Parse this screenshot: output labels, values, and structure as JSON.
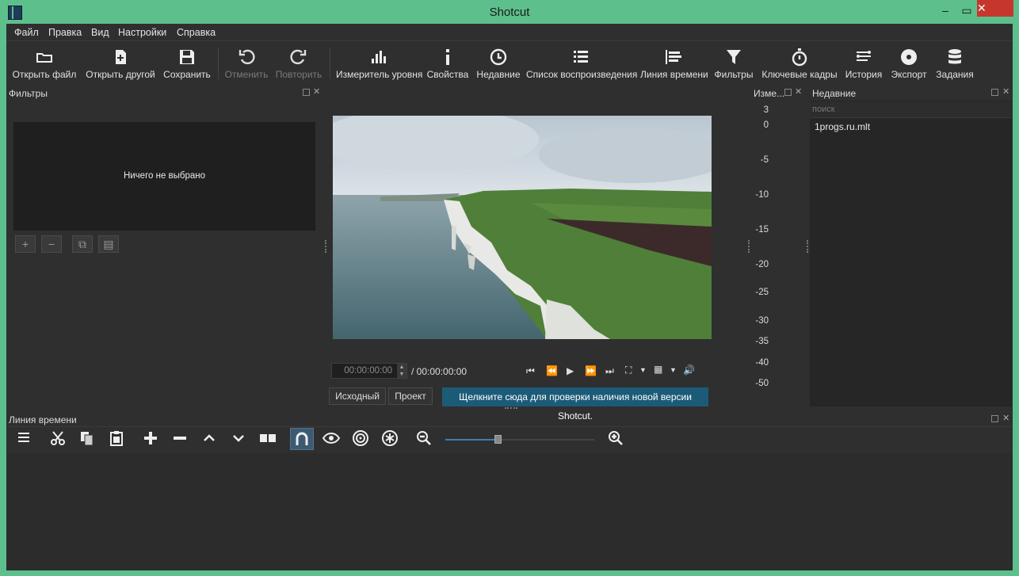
{
  "window": {
    "title": "Shotcut"
  },
  "menu": [
    "Файл",
    "Правка",
    "Вид",
    "Настройки",
    "Справка"
  ],
  "toolbar": {
    "open_file": "Открыть файл",
    "open_other": "Открыть другой",
    "save": "Сохранить",
    "undo": "Отменить",
    "redo": "Повторить",
    "peak_meter": "Измеритель уровня",
    "properties": "Свойства",
    "recent": "Недавние",
    "playlist": "Список воспроизведения",
    "timeline": "Линия времени",
    "filters": "Фильтры",
    "keyframes": "Ключевые кадры",
    "history": "История",
    "export": "Экспорт",
    "jobs": "Задания"
  },
  "filters_panel": {
    "title": "Фильтры",
    "empty_text": "Ничего не выбрано"
  },
  "player": {
    "timecode": "00:00:00:00",
    "duration": "/ 00:00:00:00",
    "tab_source": "Исходный",
    "tab_project": "Проект",
    "update_message": "Щелкните сюда для проверки наличия новой версии Shotcut."
  },
  "meter_panel": {
    "title": "Изме...",
    "ticks": [
      "3",
      "0",
      "-5",
      "-10",
      "-15",
      "-20",
      "-25",
      "-30",
      "-35",
      "-40",
      "-50"
    ]
  },
  "recent_panel": {
    "title": "Недавние",
    "search_placeholder": "поиск",
    "items": [
      "1progs.ru.mlt"
    ]
  },
  "timeline_panel": {
    "title": "Линия времени",
    "zoom_level": 0.35
  },
  "colors": {
    "accent": "#5dbf8c",
    "update_bar": "#1c5b78",
    "snap_active": "#3d5a73"
  }
}
